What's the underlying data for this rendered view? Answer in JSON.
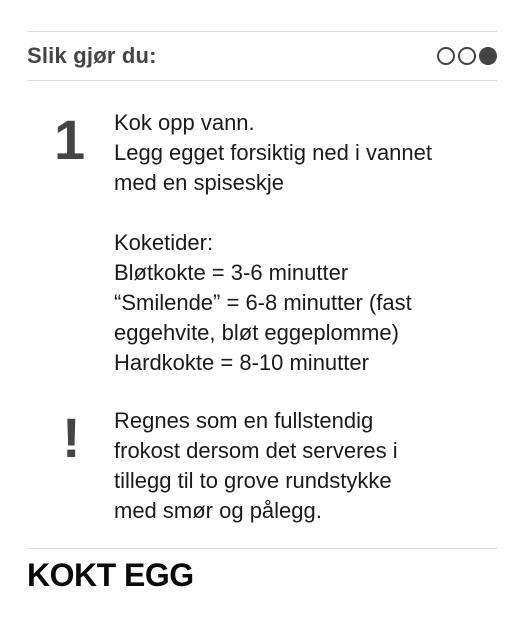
{
  "header": {
    "title": "Slik gjør du:",
    "steps_indicator": [
      "empty",
      "empty",
      "filled"
    ]
  },
  "step1": {
    "marker": "1",
    "lines": [
      "Kok opp vann.",
      "Legg egget forsiktig ned i vannet",
      "med en spiseskje",
      "",
      "Koketider:",
      "Bløtkokte = 3-6 minutter",
      "“Smilende” = 6-8 minutter (fast",
      "eggehvite, bløt eggeplomme)",
      "Hardkokte = 8-10 minutter"
    ]
  },
  "note": {
    "marker": "!",
    "lines": [
      "Regnes som en fullstendig",
      "frokost dersom det serveres i",
      "tillegg til to grove rundstykke",
      "med smør og pålegg."
    ]
  },
  "footer": {
    "title": "KOKT EGG"
  },
  "colors": {
    "heading_gray": "#444444",
    "rule": "#d9d9d9",
    "text": "#1a1a1a"
  }
}
